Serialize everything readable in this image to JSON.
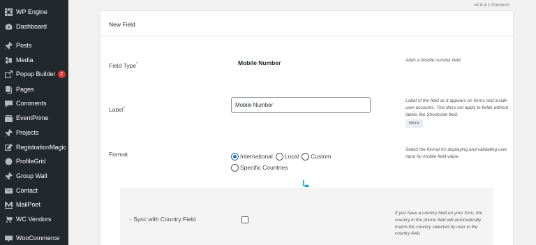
{
  "sidebar": {
    "items": [
      {
        "label": "WP Engine"
      },
      {
        "label": "Dashboard"
      },
      {
        "label": "Posts"
      },
      {
        "label": "Media"
      },
      {
        "label": "Popup Builder",
        "badge": "2"
      },
      {
        "label": "Pages"
      },
      {
        "label": "Comments"
      },
      {
        "label": "EventPrime"
      },
      {
        "label": "Projects"
      },
      {
        "label": "RegistrationMagic"
      },
      {
        "label": "ProfileGrid"
      },
      {
        "label": "Group Wall"
      },
      {
        "label": "Contact"
      },
      {
        "label": "MailPoet"
      },
      {
        "label": "WC Vendors"
      },
      {
        "label": "WooCommerce"
      }
    ]
  },
  "version": "v4.6.4.1 Premium",
  "panel": {
    "title": "New Field",
    "field_type": {
      "label": "Field Type",
      "required_mark": "*",
      "value": "Mobile Number",
      "hint": "Adds a Mobile number field"
    },
    "label_row": {
      "label": "Label",
      "required_mark": "*",
      "input_value": "Mobile Number",
      "hint": "Label of the field as it appears on forms and inside user accounts. This does not apply to fields without labels like Shortcode field.",
      "more": "More"
    },
    "format": {
      "label": "Format",
      "options": [
        "International",
        "Local",
        "Custom",
        "Specific Countries"
      ],
      "selected": "International",
      "hint": "Select the format for displaying and validating user input for mobile field value."
    },
    "sync": {
      "label": "· Sync with Country Field",
      "checked": false,
      "hint": "If you have a country field on your form, the country in the phone field will automatically match the country selected by user in the country field."
    }
  },
  "colors": {
    "sidebar_bg": "#23282d",
    "accent": "#2271b1",
    "badge": "#d63638",
    "arrow": "#00a0d2"
  }
}
